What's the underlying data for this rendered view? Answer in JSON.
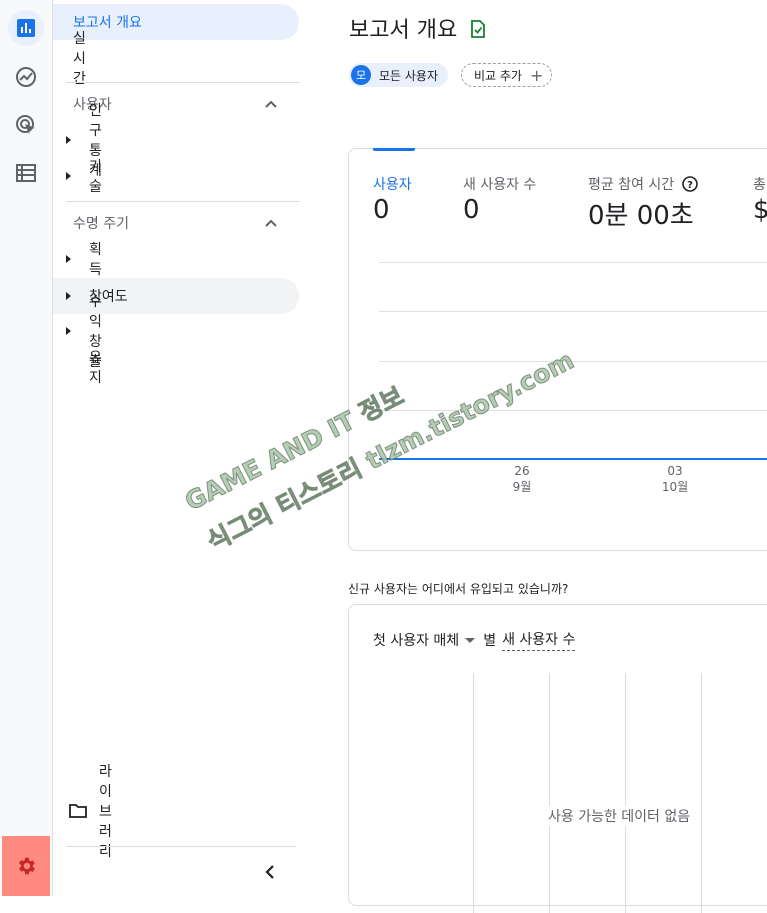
{
  "rail": {
    "items": [
      {
        "name": "reports-icon",
        "active": true
      },
      {
        "name": "explore-icon",
        "active": false
      },
      {
        "name": "advertising-icon",
        "active": false
      },
      {
        "name": "configure-icon",
        "active": false
      }
    ],
    "settings_icon": "gear-icon"
  },
  "nav": {
    "report_overview": "보고서 개요",
    "realtime": "실시간",
    "section_user": "사용자",
    "demographics": "인구통계",
    "tech": "기술",
    "section_lifecycle": "수명 주기",
    "acquisition": "획득",
    "engagement": "참여도",
    "monetization": "수익 창출",
    "retention": "유지",
    "library": "라이브러리"
  },
  "header": {
    "title": "보고서 개요",
    "user_chip_avatar": "모",
    "user_chip_label": "모든 사용자",
    "compare_label": "비교 추가",
    "compare_plus": "+"
  },
  "metrics": [
    {
      "label": "사용자",
      "value": "0"
    },
    {
      "label": "새 사용자 수",
      "value": "0"
    },
    {
      "label": "평균 참여 시간",
      "value": "0분 00초"
    },
    {
      "label": "총",
      "value": "$"
    }
  ],
  "chart_data": {
    "type": "line",
    "x_ticks": [
      {
        "day": "26",
        "month": "9월"
      },
      {
        "day": "03",
        "month": "10월"
      }
    ],
    "series": [
      {
        "values": [
          0,
          0
        ]
      }
    ],
    "grid": true
  },
  "acquisition_card": {
    "question": "신규 사용자는 어디에서 유입되고 있습니까?",
    "dimension": "첫 사용자 매체",
    "by": "별",
    "metric": "새 사용자 수",
    "empty_message": "사용 가능한 데이터 없음"
  },
  "watermark": {
    "line1": "GAME AND IT 정보",
    "line2": "식그의 티스토리 tlzm.tistory.com"
  },
  "colors": {
    "accent": "#1a73e8",
    "selected_bg": "#e8f0fe",
    "settings_highlight": "#ff8a80",
    "check_icon": "#188038"
  }
}
